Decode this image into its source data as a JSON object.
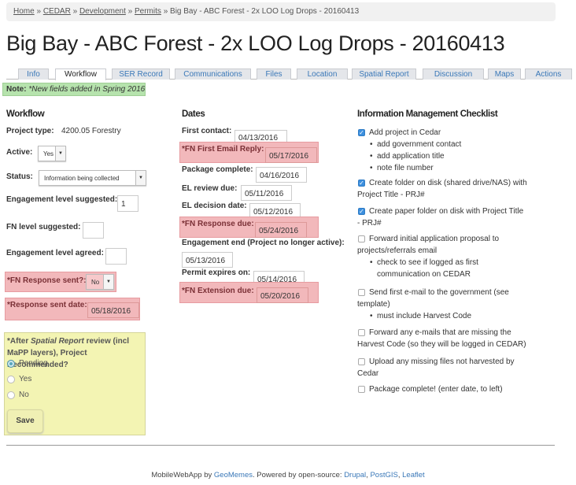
{
  "breadcrumb": {
    "items": [
      "Home",
      "CEDAR",
      "Development",
      "Permits"
    ],
    "separator": "»",
    "current": "Big Bay - ABC Forest - 2x LOO Log Drops - 20160413"
  },
  "page_title": "Big Bay - ABC Forest - 2x LOO Log Drops - 20160413",
  "tabs": [
    {
      "label": "Info"
    },
    {
      "label": "Workflow",
      "active": true
    },
    {
      "label": "SER Record"
    },
    {
      "label": "Communications"
    },
    {
      "label": "Files"
    },
    {
      "label": "Location"
    },
    {
      "label": "Spatial Report"
    },
    {
      "label": "Discussion"
    },
    {
      "label": "Maps"
    },
    {
      "label": "Actions"
    }
  ],
  "note": {
    "label": "Note:",
    "text": "*New fields added in Spring 2016"
  },
  "workflow": {
    "heading": "Workflow",
    "project_type_label": "Project type:",
    "project_type": "4200.05 Forestry",
    "active_label": "Active:",
    "active": "Yes",
    "status_label": "Status:",
    "status": "Information being collected",
    "el_suggested_label": "Engagement level suggested:",
    "el_suggested": "1",
    "fn_level_label": "FN level suggested:",
    "fn_level": "",
    "el_agreed_label": "Engagement level agreed:",
    "el_agreed": "",
    "fn_response_sent_label": "*FN Response sent?:",
    "fn_response_sent": "No",
    "response_sent_date_label": "*Response sent date:",
    "response_sent_date": "05/18/2016",
    "recommend": {
      "q_prefix": "*After ",
      "q_em": "Spatial Report",
      "q_suffix": " review (incl MaPP layers), Project Recommended?",
      "options": [
        "Pending",
        "Yes",
        "No"
      ],
      "selected": "Pending"
    },
    "save_label": "Save"
  },
  "dates": {
    "heading": "Dates",
    "first_contact_label": "First contact:",
    "first_contact": "04/13/2016",
    "fn_first_email_label": "*FN First Email Reply:",
    "fn_first_email": "05/17/2016",
    "package_complete_label": "Package complete:",
    "package_complete": "04/16/2016",
    "el_review_label": "EL review due:",
    "el_review": "05/11/2016",
    "el_decision_label": "EL decision date:",
    "el_decision": "05/12/2016",
    "fn_response_due_label": "*FN Response due:",
    "fn_response_due": "05/24/2016",
    "engagement_end_label": "Engagement end (Project no longer active):",
    "engagement_end": "05/13/2016",
    "permit_expires_label": "Permit expires on:",
    "permit_expires": "05/14/2016",
    "fn_extension_label": "*FN Extension due:",
    "fn_extension": "05/20/2016"
  },
  "checklist": {
    "heading": "Information Management Checklist",
    "items": [
      {
        "l1": "Add project in Cedar",
        "l2": "",
        "checked": true,
        "bullets": [
          "add government contact",
          "add application title",
          "note file number"
        ]
      },
      {
        "l1": "Create folder on disk (shared drive/NAS) with",
        "l2": "Project Title - PRJ#",
        "checked": true,
        "bullets": []
      },
      {
        "l1": "Create paper folder on disk with Project Title",
        "l2": "- PRJ#",
        "checked": true,
        "bullets": []
      },
      {
        "l1": "Forward initial application proposal to",
        "l2": "projects/referrals email",
        "checked": false,
        "bullets": [
          "check to see if logged as first",
          "communication on CEDAR"
        ]
      },
      {
        "l1": "Send first e-mail to the government (see",
        "l2": "template)",
        "checked": false,
        "bullets": [
          "must include Harvest Code"
        ]
      },
      {
        "l1": "Forward any e-mails that are missing the",
        "l2": "Harvest Code (so they will be logged in CEDAR)",
        "checked": false,
        "bullets": []
      },
      {
        "l1": "Upload any missing files not harvested by",
        "l2": "Cedar",
        "checked": false,
        "bullets": []
      },
      {
        "l1": "Package complete! (enter date, to left)",
        "l2": "",
        "checked": false,
        "bullets": []
      }
    ]
  },
  "footer": {
    "prefix": "MobileWebApp by ",
    "geomemes": "GeoMemes",
    "mid": ". Powered by open-source: ",
    "drupal": "Drupal",
    "c1": ", ",
    "postgis": "PostGIS",
    "c2": ", ",
    "leaflet": "Leaflet"
  },
  "colors": {
    "link": "#3a78b8",
    "note_bg": "#b6e3ad",
    "highlight_pink": "#f2b8bb",
    "yellow_box": "#f3f4b3",
    "checkbox": "#3c8fde"
  }
}
